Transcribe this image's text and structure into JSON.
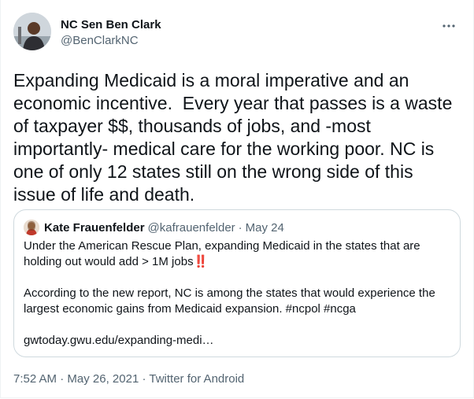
{
  "author": {
    "display_name": "NC Sen Ben Clark",
    "handle": "@BenClarkNC"
  },
  "more_icon": "more-horizontal-icon",
  "tweet": {
    "text": "Expanding Medicaid is a moral imperative and an\neconomic incentive.  Every year that passes is a waste\nof taxpayer $$, thousands of jobs, and -most\nimportantly- medical care for the working poor. NC is\none of only 12 states still on the wrong side of this\nissue of life and death."
  },
  "quote": {
    "display_name": "Kate Frauenfelder",
    "handle": "@kafrauenfelder",
    "separator": "·",
    "date": "May 24",
    "p1_text": "Under the American Rescue Plan, expanding Medicaid in the states that are holding out would add > 1M jobs",
    "p1_emoji": "‼️",
    "p2_text": "According to the new report, NC is among the states that would experience the largest economic gains from Medicaid expansion. #ncpol #ncga",
    "link": "gwtoday.gwu.edu/expanding-medi…"
  },
  "meta": {
    "time": "7:52 AM",
    "sep1": "·",
    "date": "May 26, 2021",
    "sep2": "·",
    "source": "Twitter for Android"
  },
  "colors": {
    "text": "#0f1419",
    "secondary": "#536471",
    "border": "#cfd9de",
    "emoji": "#e0245e"
  }
}
